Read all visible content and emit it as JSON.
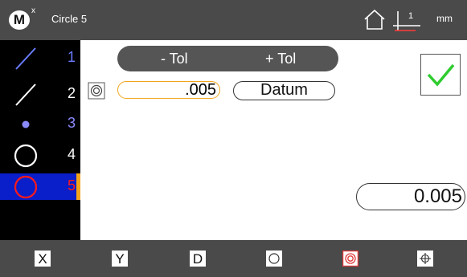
{
  "header": {
    "logo": "M",
    "logo_sup": "x",
    "title": "Circle 5",
    "datum_number": "1",
    "units": "mm",
    "icons": [
      "home-icon",
      "datum-axis-icon"
    ]
  },
  "features": [
    {
      "number": "1",
      "icon": "line-icon",
      "color": "#6b7cff"
    },
    {
      "number": "2",
      "icon": "line-icon",
      "color": "#ffffff"
    },
    {
      "number": "3",
      "icon": "point-icon",
      "color": "#8b8bff"
    },
    {
      "number": "4",
      "icon": "circle-icon",
      "color": "#ffffff"
    },
    {
      "number": "5",
      "icon": "circle-icon",
      "color": "#ff1a1a",
      "selected": true
    }
  ],
  "tolerance": {
    "minus_label": "- Tol",
    "plus_label": "+ Tol",
    "value": ".005",
    "datum_label": "Datum",
    "result": "0.005"
  },
  "toolbar": {
    "x_label": "X",
    "y_label": "Y",
    "d_label": "D",
    "icons": [
      "circularity-icon",
      "concentricity-icon",
      "position-icon"
    ]
  },
  "colors": {
    "bar": "#4a4a4a",
    "selection": "#0a1ec9",
    "accent": "#f2a51a",
    "check": "#2ecc2e",
    "active": "#e03a3a"
  }
}
